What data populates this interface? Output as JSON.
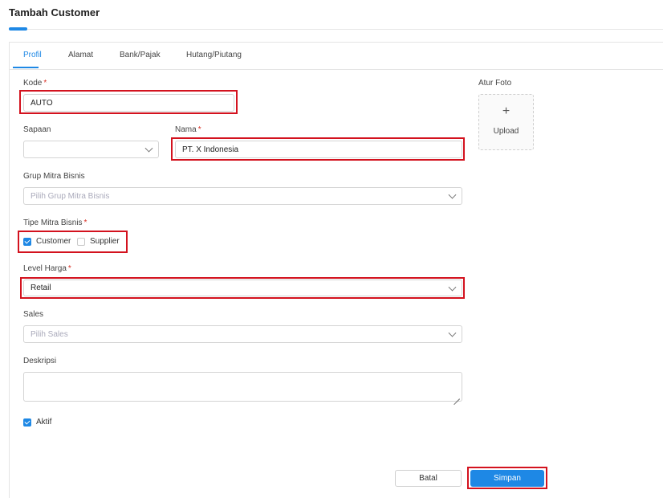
{
  "header": {
    "title": "Tambah Customer"
  },
  "tabs": [
    {
      "label": "Profil",
      "active": true
    },
    {
      "label": "Alamat",
      "active": false
    },
    {
      "label": "Bank/Pajak",
      "active": false
    },
    {
      "label": "Hutang/Piutang",
      "active": false
    }
  ],
  "form": {
    "kode": {
      "label": "Kode",
      "required": "*",
      "value": "AUTO"
    },
    "sapaan": {
      "label": "Sapaan",
      "value": ""
    },
    "nama": {
      "label": "Nama",
      "required": "*",
      "value": "PT. X Indonesia"
    },
    "grup": {
      "label": "Grup Mitra Bisnis",
      "placeholder": "Pilih Grup Mitra Bisnis"
    },
    "tipe": {
      "label": "Tipe Mitra Bisnis",
      "required": "*",
      "options": [
        {
          "label": "Customer",
          "checked": true
        },
        {
          "label": "Supplier",
          "checked": false
        }
      ]
    },
    "level_harga": {
      "label": "Level Harga",
      "required": "*",
      "value": "Retail"
    },
    "sales": {
      "label": "Sales",
      "placeholder": "Pilih Sales"
    },
    "deskripsi": {
      "label": "Deskripsi",
      "value": ""
    },
    "aktif": {
      "label": "Aktif",
      "checked": true
    }
  },
  "photo": {
    "label": "Atur Foto",
    "plus": "+",
    "upload_label": "Upload"
  },
  "actions": {
    "cancel_label": "Batal",
    "save_label": "Simpan"
  },
  "colors": {
    "accent": "#1e88e5",
    "highlight": "#d3121e"
  },
  "icons": [
    "chevron-down-icon",
    "plus-icon",
    "checkbox-checked-icon",
    "resize-handle-icon"
  ]
}
